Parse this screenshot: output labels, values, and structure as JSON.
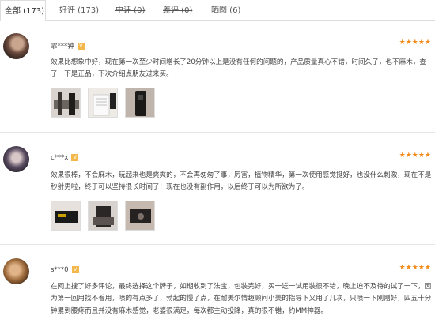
{
  "tabs": [
    {
      "label": "全部 (173)",
      "active": true,
      "disabled": false
    },
    {
      "label": "好评 (173)",
      "active": false,
      "disabled": false
    },
    {
      "label": "中评 (0)",
      "active": false,
      "disabled": true
    },
    {
      "label": "差评 (0)",
      "active": false,
      "disabled": true
    },
    {
      "label": "晒图 (6)",
      "active": false,
      "disabled": false
    }
  ],
  "reviews": [
    {
      "user": "霏***钟",
      "stars": "★★★★★",
      "content": "效果比想象中好，现在第一次至少时间增长了20分钟以上是没有任何的问题的，产品质量真心不错，时间久了，也不麻木，查了一下是正品，下次介绍点朋友过来买。",
      "thumb_count": 3
    },
    {
      "user": "c***x",
      "stars": "★★★★★",
      "content": "效果很棒，不会麻木，玩起来也是爽爽的，不会再匆匆了事，厉害，植物精华，第一次使用感觉挺好，也没什么刺激，现在不是秒射男啦，终于可以坚持很长时间了！现在也没有副作用，以后终于可以为所欲为了。",
      "thumb_count": 3
    },
    {
      "user": "s***0",
      "stars": "★★★★★",
      "content": "在网上搜了好多评论，最终选择这个牌子，如期收到了法宝，包装完好，买一送一试用装很不错，晚上迫不及待的试了一下，因为第一回用找不着用，喷的有点多了，勃起的慢了点，在耐美尔情趣顾问小美的指导下又用了几次，只喷一下刚刚好，四五十分钟累到腰疼而且并没有麻木感觉，老婆很满足，每次都主动投降，真的很不错，约MM神器。",
      "thumb_count": 0
    }
  ],
  "vip_badge": "V",
  "colors": {
    "star": "#f38b1a",
    "vip": "#f2b84b"
  }
}
